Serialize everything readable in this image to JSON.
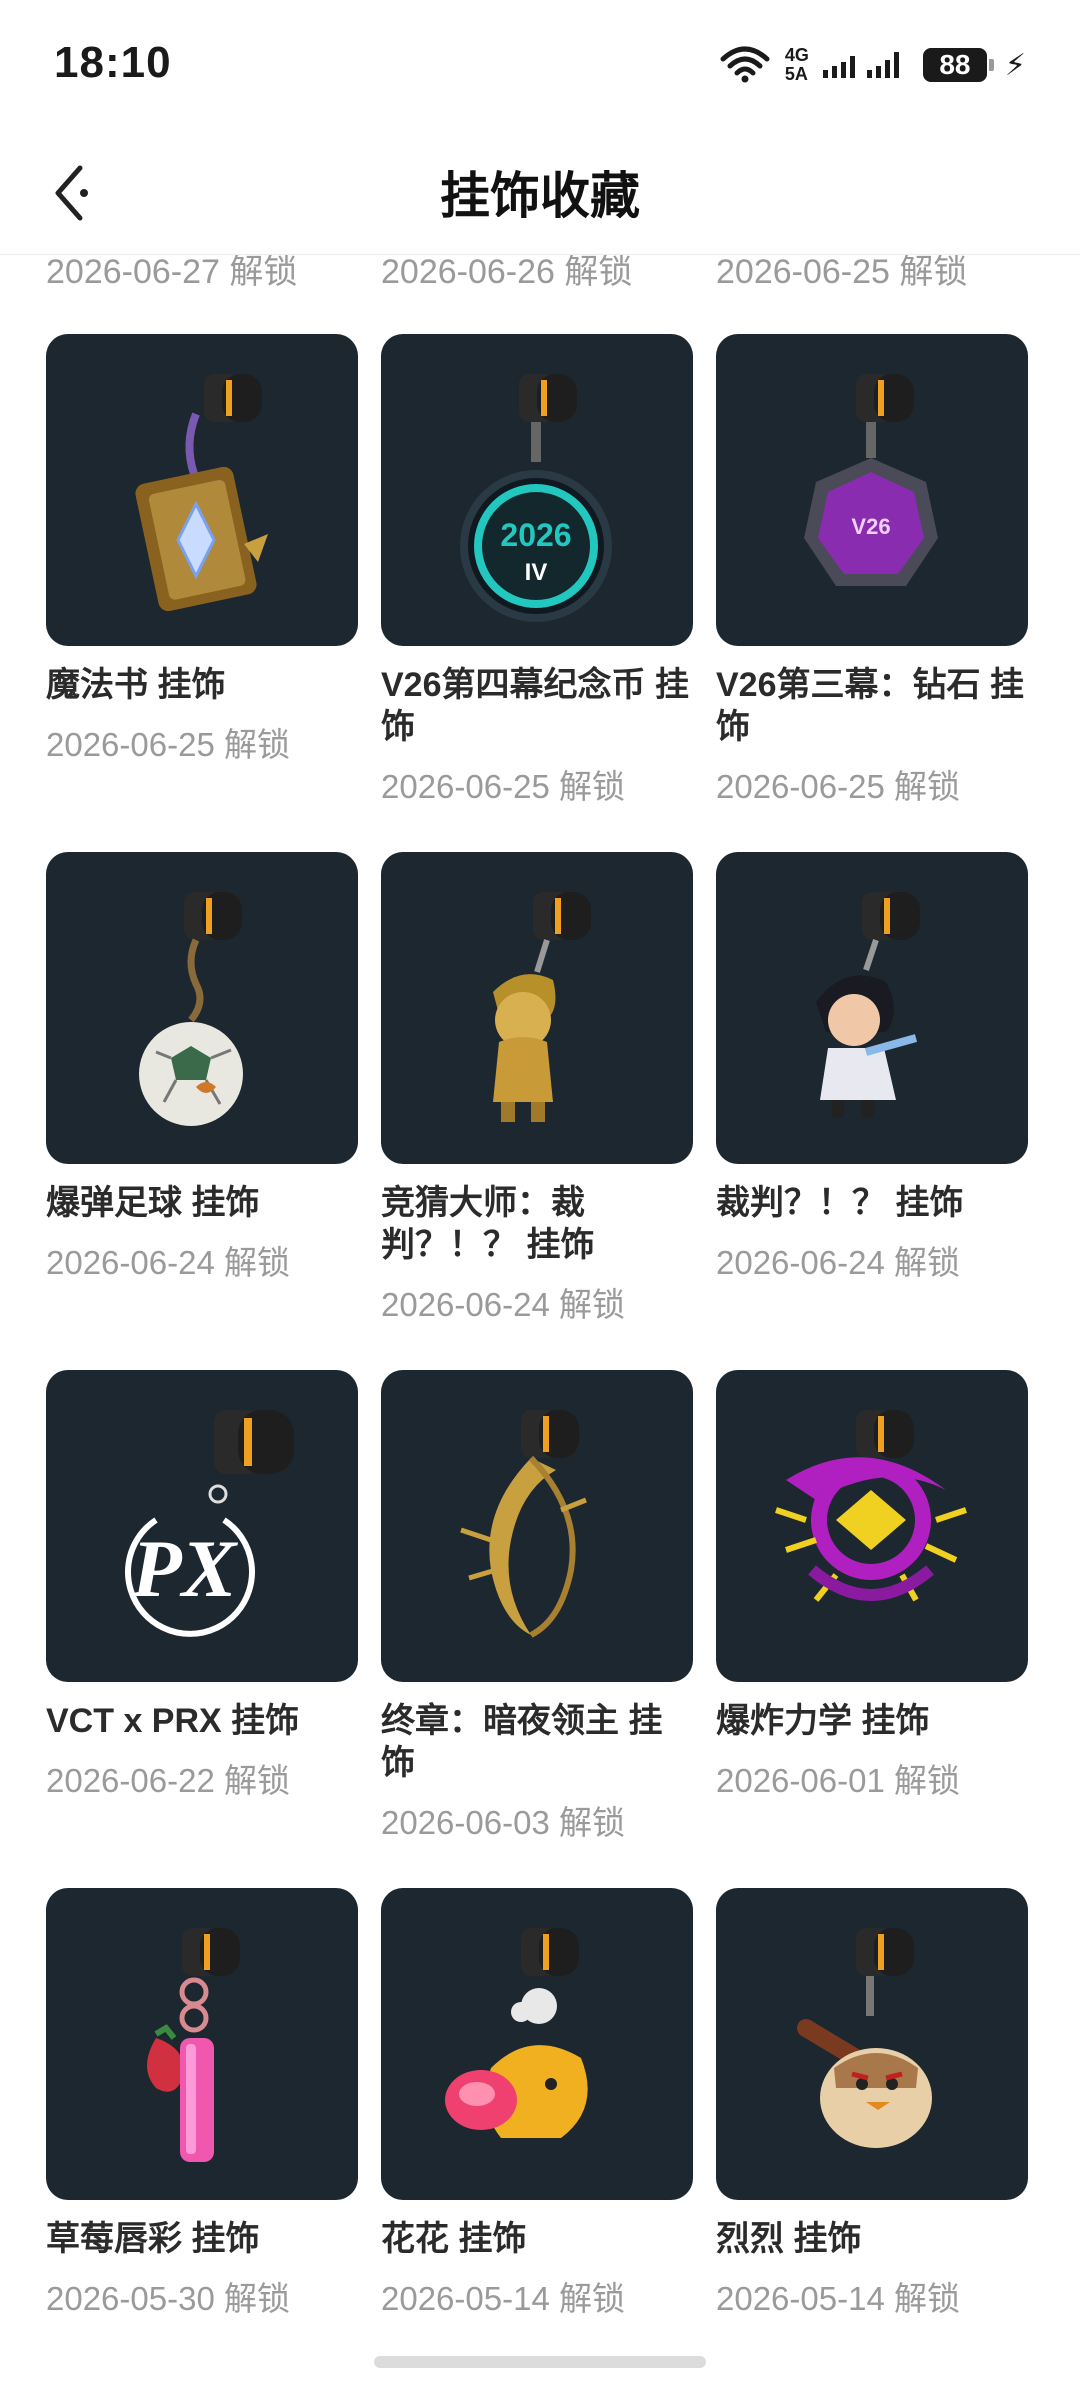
{
  "status": {
    "time": "18:10",
    "network_top": "4G",
    "network_bottom": "5A",
    "battery": "88"
  },
  "header": {
    "title": "挂饰收藏"
  },
  "colors": {
    "card_bg": "#1c2730",
    "accent_orange": "#f0a020",
    "date_gray": "#9a9a9a"
  },
  "previous_row_dates": [
    "2026-06-27 解锁",
    "2026-06-26 解锁",
    "2026-06-25 解锁"
  ],
  "items": [
    {
      "name": "魔法书 挂饰",
      "date": "2026-06-25 解锁",
      "icon": "magic-book-charm"
    },
    {
      "name": "V26第四幕纪念币 挂饰",
      "date": "2026-06-25 解锁",
      "icon": "coin-charm",
      "coin_text": "2026",
      "coin_sub": "IV"
    },
    {
      "name": "V26第三幕：钻石 挂饰",
      "date": "2026-06-25 解锁",
      "icon": "diamond-charm",
      "badge_text": "V26"
    },
    {
      "name": "爆弹足球 挂饰",
      "date": "2026-06-24 解锁",
      "icon": "football-charm"
    },
    {
      "name": "竞猜大师：裁判？！？ 挂饰",
      "date": "2026-06-24 解锁",
      "icon": "gold-figure-charm"
    },
    {
      "name": "裁判？！？ 挂饰",
      "date": "2026-06-24 解锁",
      "icon": "figure-charm"
    },
    {
      "name": "VCT x PRX 挂饰",
      "date": "2026-06-22 解锁",
      "icon": "prx-logo-charm",
      "logo_text": "PX"
    },
    {
      "name": "终章：暗夜领主 挂饰",
      "date": "2026-06-03 解锁",
      "icon": "crescent-charm"
    },
    {
      "name": "爆炸力学 挂饰",
      "date": "2026-06-01 解锁",
      "icon": "explosion-charm"
    },
    {
      "name": "草莓唇彩 挂饰",
      "date": "2026-05-30 解锁",
      "icon": "lipgloss-charm"
    },
    {
      "name": "花花 挂饰",
      "date": "2026-05-14 解锁",
      "icon": "flower-creature-charm"
    },
    {
      "name": "烈烈 挂饰",
      "date": "2026-05-14 解锁",
      "icon": "bird-creature-charm"
    }
  ]
}
